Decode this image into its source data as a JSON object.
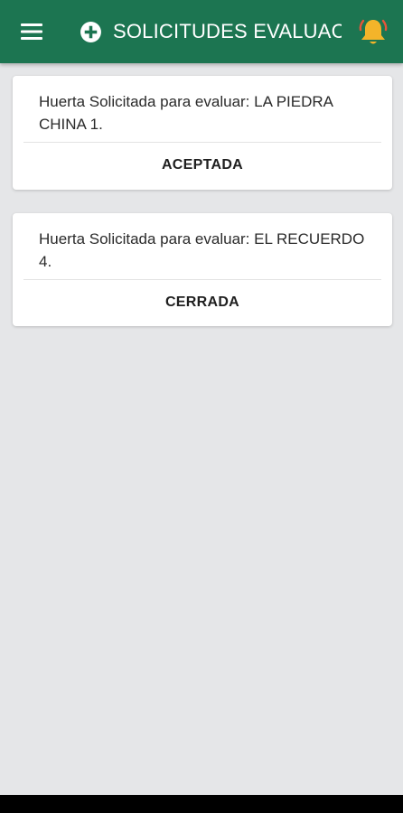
{
  "appbar": {
    "title": "SOLICITUDES EVALUACION",
    "menu_icon": "hamburger-menu-icon",
    "add_icon": "add-circle-icon",
    "bell_icon": "notification-bell-icon",
    "colors": {
      "bar": "#1c7551",
      "bell": "#f3b42a",
      "bell_alert": "#e8553a"
    }
  },
  "requests": [
    {
      "text": "Huerta Solicitada para evaluar: LA PIEDRA CHINA 1.",
      "status": "ACEPTADA"
    },
    {
      "text": "Huerta Solicitada para evaluar: EL RECUERDO 4.",
      "status": "CERRADA"
    }
  ]
}
